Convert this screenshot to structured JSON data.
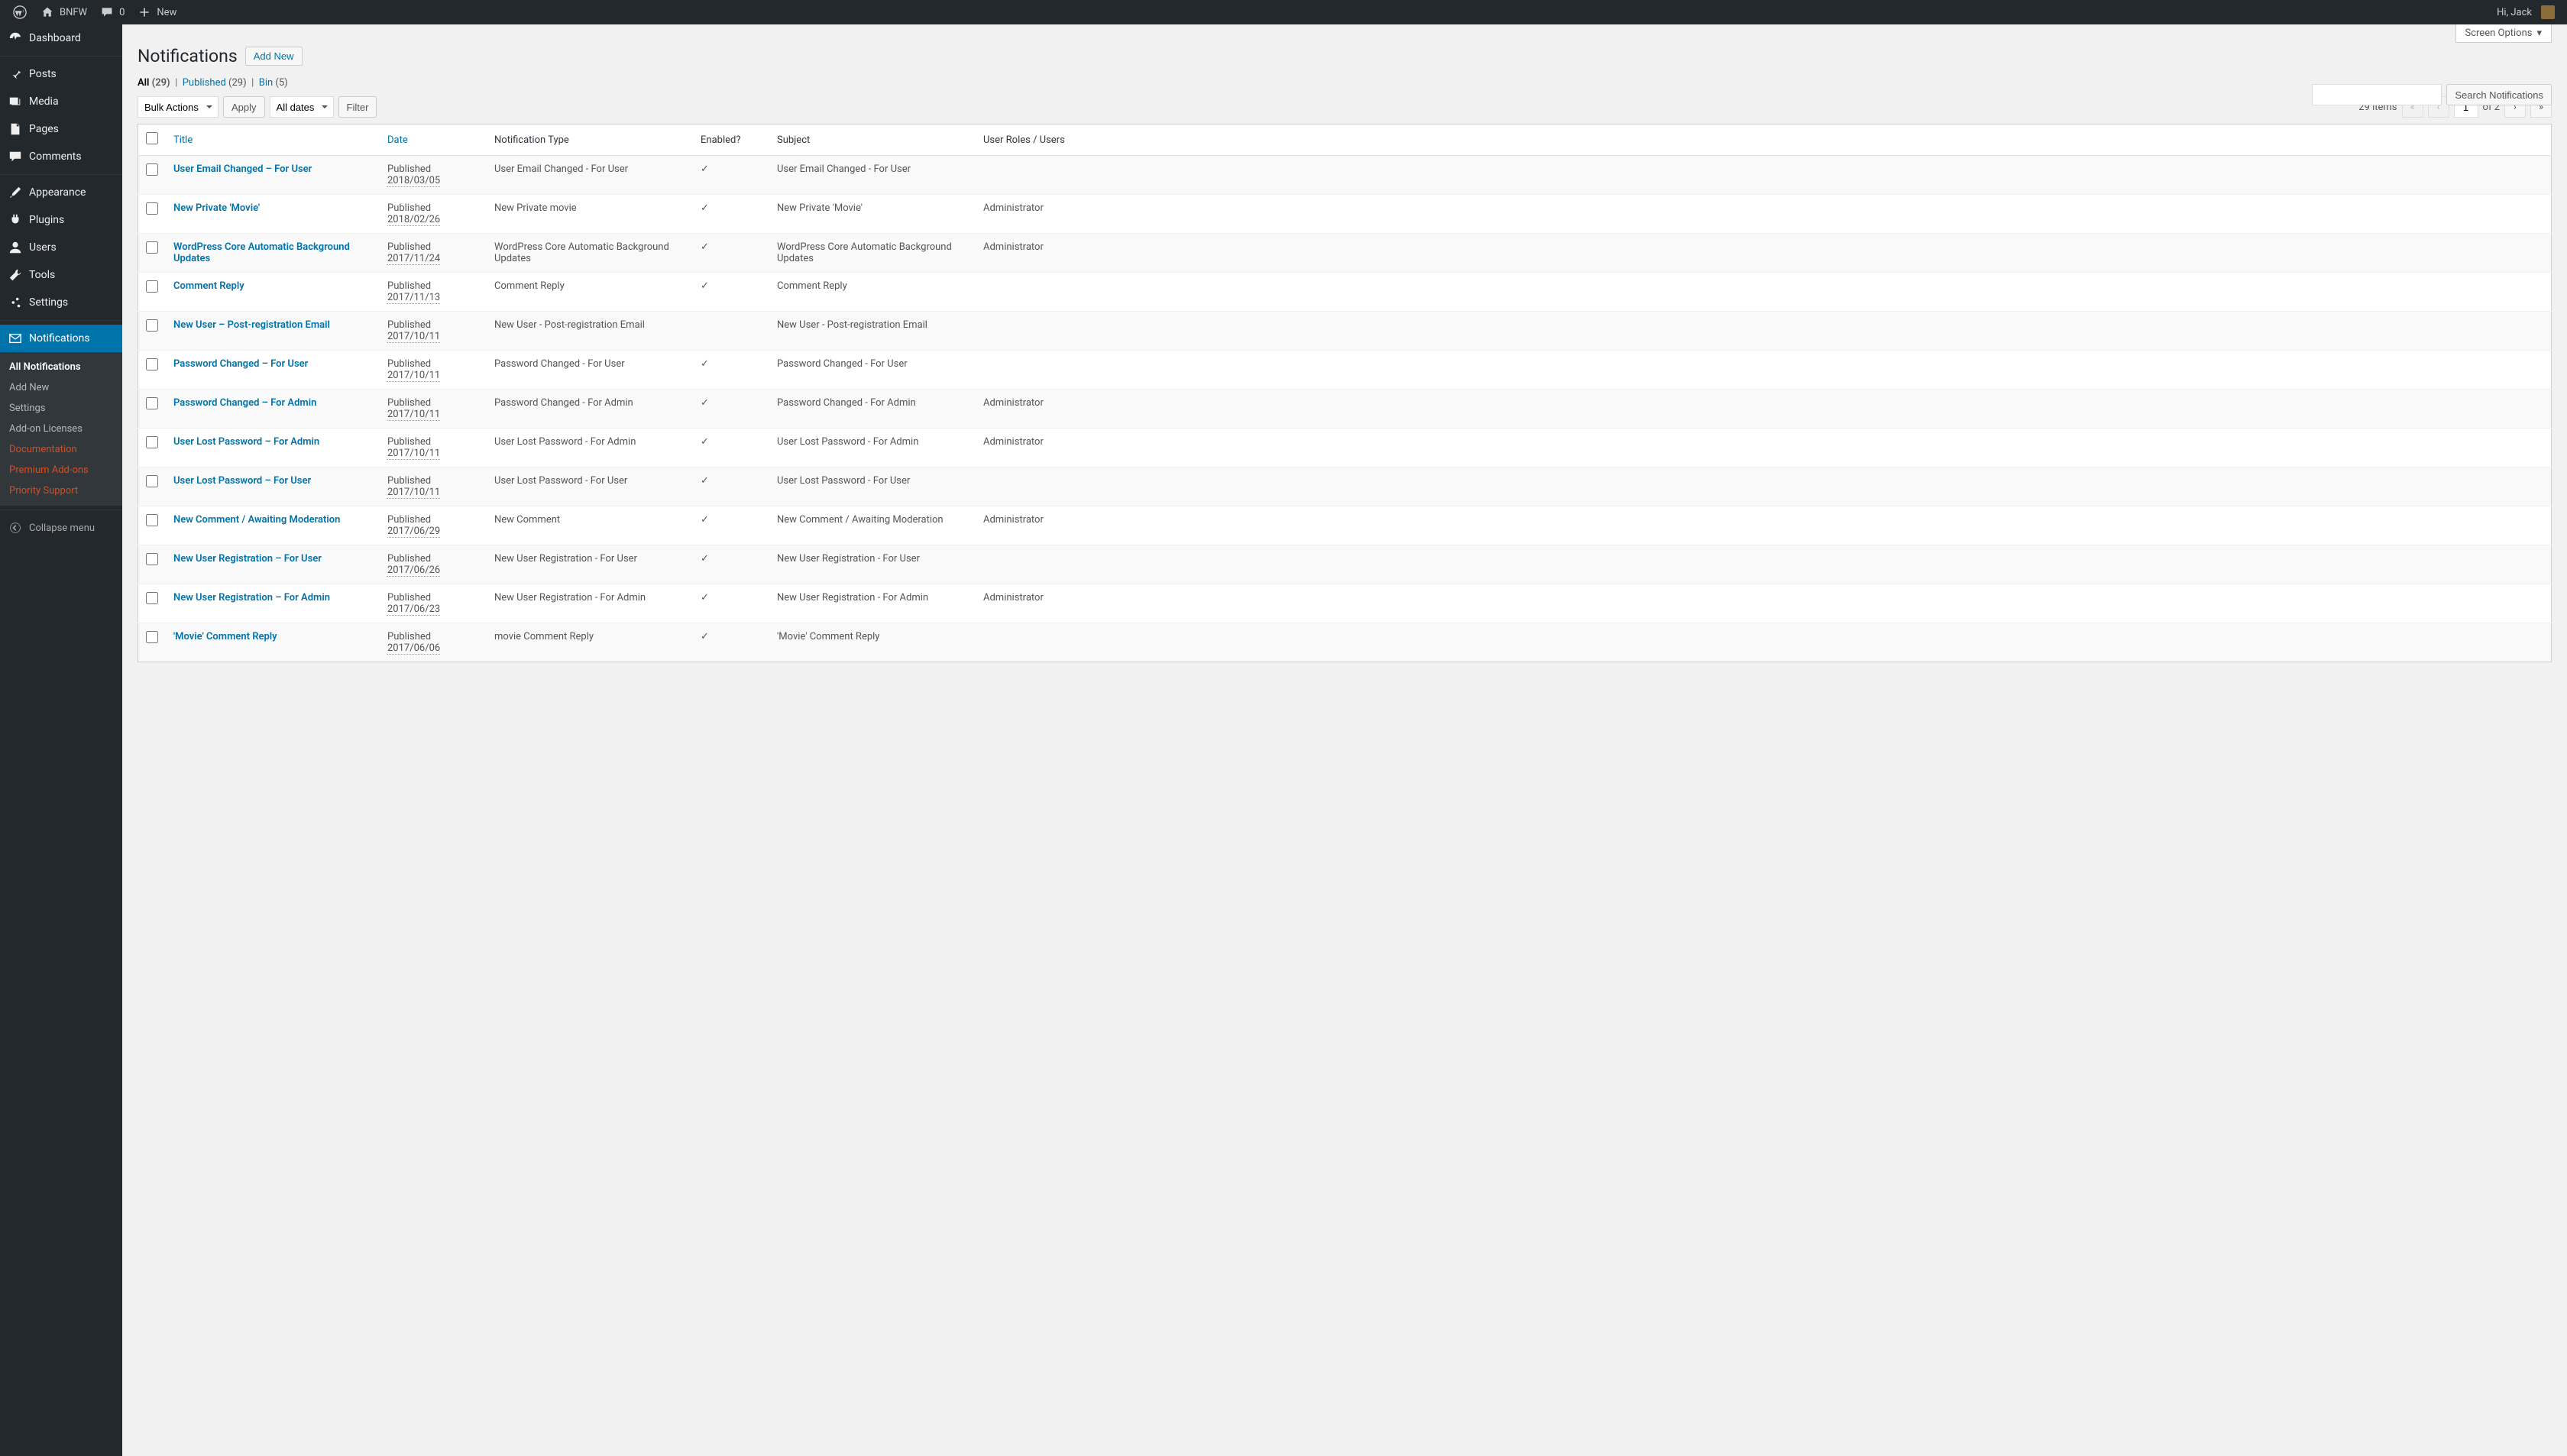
{
  "adminbar": {
    "site_name": "BNFW",
    "comments_count": "0",
    "new_label": "New",
    "greeting": "Hi, Jack"
  },
  "sidebar": {
    "items": [
      {
        "label": "Dashboard"
      },
      {
        "label": "Posts"
      },
      {
        "label": "Media"
      },
      {
        "label": "Pages"
      },
      {
        "label": "Comments"
      },
      {
        "label": "Appearance"
      },
      {
        "label": "Plugins"
      },
      {
        "label": "Users"
      },
      {
        "label": "Tools"
      },
      {
        "label": "Settings"
      },
      {
        "label": "Notifications"
      }
    ],
    "submenu": [
      {
        "label": "All Notifications",
        "current": true
      },
      {
        "label": "Add New"
      },
      {
        "label": "Settings"
      },
      {
        "label": "Add-on Licenses"
      },
      {
        "label": "Documentation",
        "ext": true
      },
      {
        "label": "Premium Add-ons",
        "ext": true
      },
      {
        "label": "Priority Support",
        "ext": true
      }
    ],
    "collapse": "Collapse menu"
  },
  "screen_options": "Screen Options",
  "page": {
    "title": "Notifications",
    "add_new": "Add New"
  },
  "filters": {
    "all": "All",
    "all_count": "(29)",
    "published": "Published",
    "published_count": "(29)",
    "bin": "Bin",
    "bin_count": "(5)",
    "sep": "|"
  },
  "bulk": {
    "label": "Bulk Actions",
    "apply": "Apply",
    "dates": "All dates",
    "filter": "Filter"
  },
  "search": {
    "button": "Search Notifications"
  },
  "pagination": {
    "items": "29 items",
    "current": "1",
    "of": "of 2"
  },
  "columns": {
    "title": "Title",
    "date": "Date",
    "type": "Notification Type",
    "enabled": "Enabled?",
    "subject": "Subject",
    "roles": "User Roles / Users"
  },
  "rows": [
    {
      "title": "User Email Changed – For User",
      "status": "Published",
      "date": "2018/03/05",
      "type": "User Email Changed - For User",
      "enabled": "✓",
      "subject": "User Email Changed - For User",
      "roles": ""
    },
    {
      "title": "New Private 'Movie'",
      "status": "Published",
      "date": "2018/02/26",
      "type": "New Private movie",
      "enabled": "✓",
      "subject": "New Private 'Movie'",
      "roles": "Administrator"
    },
    {
      "title": "WordPress Core Automatic Background Updates",
      "status": "Published",
      "date": "2017/11/24",
      "type": "WordPress Core Automatic Background Updates",
      "enabled": "✓",
      "subject": "WordPress Core Automatic Background Updates",
      "roles": "Administrator"
    },
    {
      "title": "Comment Reply",
      "status": "Published",
      "date": "2017/11/13",
      "type": "Comment Reply",
      "enabled": "✓",
      "subject": "Comment Reply",
      "roles": ""
    },
    {
      "title": "New User – Post-registration Email",
      "status": "Published",
      "date": "2017/10/11",
      "type": "New User - Post-registration Email",
      "enabled": "",
      "subject": "New User - Post-registration Email",
      "roles": ""
    },
    {
      "title": "Password Changed – For User",
      "status": "Published",
      "date": "2017/10/11",
      "type": "Password Changed - For User",
      "enabled": "✓",
      "subject": "Password Changed - For User",
      "roles": ""
    },
    {
      "title": "Password Changed – For Admin",
      "status": "Published",
      "date": "2017/10/11",
      "type": "Password Changed - For Admin",
      "enabled": "✓",
      "subject": "Password Changed - For Admin",
      "roles": "Administrator"
    },
    {
      "title": "User Lost Password – For Admin",
      "status": "Published",
      "date": "2017/10/11",
      "type": "User Lost Password - For Admin",
      "enabled": "✓",
      "subject": "User Lost Password - For Admin",
      "roles": "Administrator"
    },
    {
      "title": "User Lost Password – For User",
      "status": "Published",
      "date": "2017/10/11",
      "type": "User Lost Password - For User",
      "enabled": "✓",
      "subject": "User Lost Password - For User",
      "roles": ""
    },
    {
      "title": "New Comment / Awaiting Moderation",
      "status": "Published",
      "date": "2017/06/29",
      "type": "New Comment",
      "enabled": "✓",
      "subject": "New Comment / Awaiting Moderation",
      "roles": "Administrator"
    },
    {
      "title": "New User Registration – For User",
      "status": "Published",
      "date": "2017/06/26",
      "type": "New User Registration - For User",
      "enabled": "✓",
      "subject": "New User Registration - For User",
      "roles": ""
    },
    {
      "title": "New User Registration – For Admin",
      "status": "Published",
      "date": "2017/06/23",
      "type": "New User Registration - For Admin",
      "enabled": "✓",
      "subject": "New User Registration - For Admin",
      "roles": "Administrator"
    },
    {
      "title": "'Movie' Comment Reply",
      "status": "Published",
      "date": "2017/06/06",
      "type": "movie Comment Reply",
      "enabled": "✓",
      "subject": "'Movie' Comment Reply",
      "roles": ""
    }
  ]
}
